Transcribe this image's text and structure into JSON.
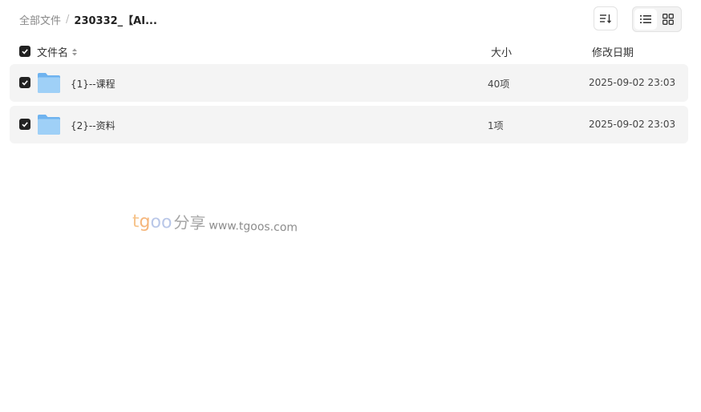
{
  "breadcrumb": {
    "root": "全部文件",
    "separator": "/",
    "current": "230332_【AI..."
  },
  "toolbar": {
    "sort_icon": "sort-descending-icon",
    "view_list_icon": "list-view-icon",
    "view_grid_icon": "grid-view-icon",
    "active_view": "list"
  },
  "table": {
    "headers": {
      "name": "文件名",
      "size": "大小",
      "date": "修改日期"
    },
    "rows": [
      {
        "name": "{1}--课程",
        "size": "40项",
        "date": "2025-09-02 23:03",
        "checked": true,
        "icon": "folder-icon"
      },
      {
        "name": "{2}--资料",
        "size": "1项",
        "date": "2025-09-02 23:03",
        "checked": true,
        "icon": "folder-icon"
      }
    ]
  },
  "watermark": {
    "brand_t": "t",
    "brand_g": "g",
    "brand_oo": "oo",
    "brand_zh": "分享",
    "url": "www.tgoos.com"
  },
  "colors": {
    "row_background": "#f4f4f4",
    "checkbox": "#222222",
    "folder_light": "#9fd0f7",
    "folder_dark": "#6fb3ef"
  }
}
